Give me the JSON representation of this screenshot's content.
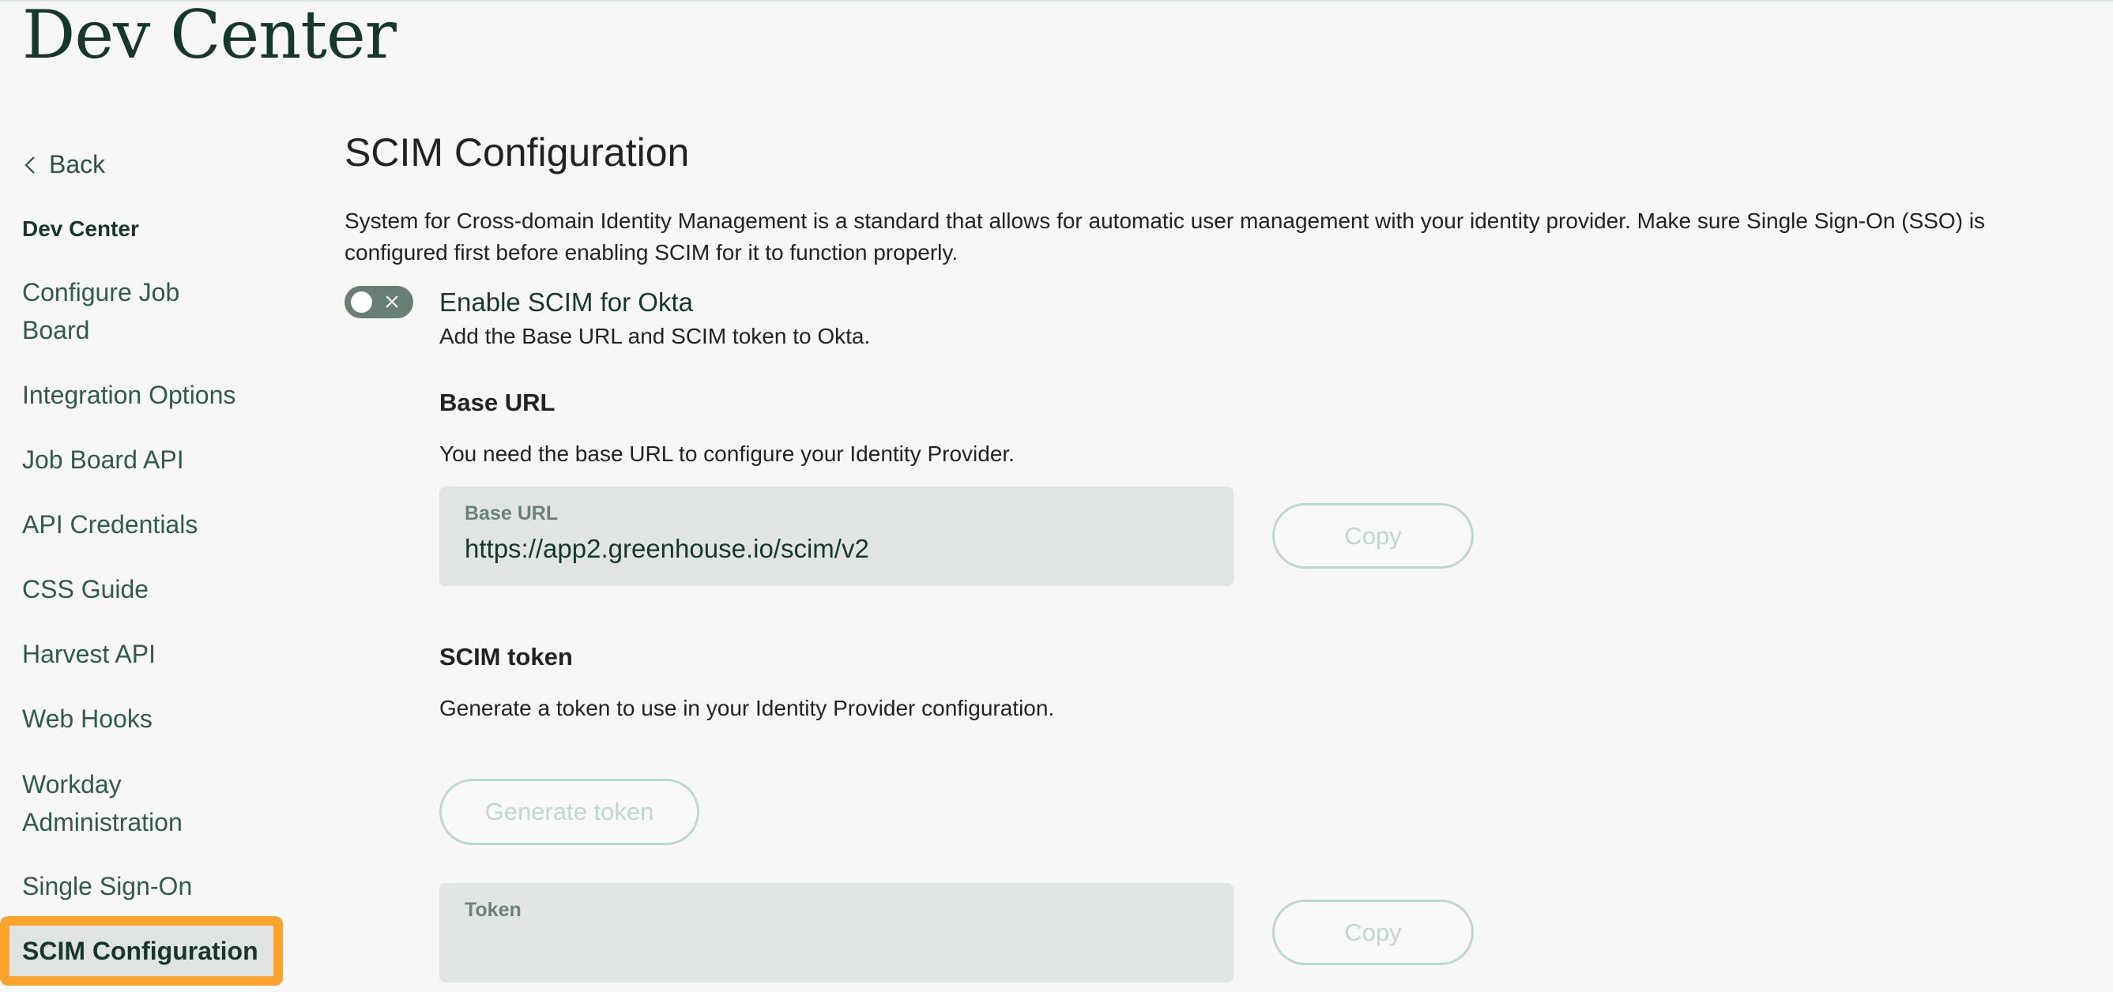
{
  "app": {
    "title": "Dev Center"
  },
  "sidebar": {
    "back_label": "Back",
    "section_label": "Dev Center",
    "items": [
      {
        "label": "Configure Job Board",
        "lines": [
          "Configure Job",
          "Board"
        ]
      },
      {
        "label": "Integration Options"
      },
      {
        "label": "Job Board API"
      },
      {
        "label": "API Credentials"
      },
      {
        "label": "CSS Guide"
      },
      {
        "label": "Harvest API"
      },
      {
        "label": "Web Hooks"
      },
      {
        "label": "Workday Administration",
        "lines": [
          "Workday",
          "Administration"
        ]
      },
      {
        "label": "Single Sign-On"
      },
      {
        "label": "SCIM Configuration",
        "active": true
      }
    ],
    "active_highlight_color": "#fda22c"
  },
  "main": {
    "title": "SCIM Configuration",
    "intro": "System for Cross-domain Identity Management is a standard that allows for automatic user management with your identity provider. Make sure Single Sign-On (SSO) is configured first before enabling SCIM for it to function properly.",
    "toggle": {
      "label": "Enable SCIM for Okta",
      "description": "Add the Base URL and SCIM token to Okta.",
      "state": "off"
    },
    "base_url": {
      "heading": "Base URL",
      "description": "You need the base URL to configure your Identity Provider.",
      "field_label": "Base URL",
      "field_value": "https://app2.greenhouse.io/scim/v2",
      "copy_label": "Copy"
    },
    "scim_token": {
      "heading": "SCIM token",
      "description": "Generate a token to use in your Identity Provider configuration.",
      "generate_label": "Generate token",
      "field_label": "Token",
      "field_value": "",
      "copy_label": "Copy"
    }
  },
  "colors": {
    "brand_dark_green": "#15372c",
    "nav_text": "#2f5b4d",
    "toggle_off": "#687f76",
    "field_bg": "#e0e5e3",
    "disabled_button": "#bcd9ce",
    "background": "#f7f7f7"
  }
}
